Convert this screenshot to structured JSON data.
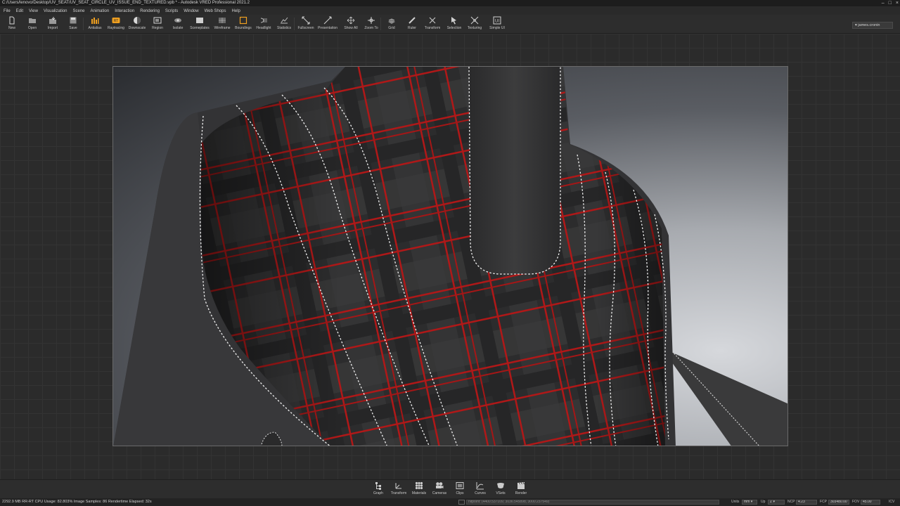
{
  "window": {
    "title": "C:/Users/lenovo/Desktop/UV_SEAT/UV_SEAT_CIRCLE_UV_ISSUE_END_TEXTURED.vpb * - Autodesk VRED Professional 2021.2"
  },
  "menu": [
    "File",
    "Edit",
    "View",
    "Visualization",
    "Scene",
    "Animation",
    "Interaction",
    "Rendering",
    "Scripts",
    "Window",
    "Web Shops",
    "Help"
  ],
  "toolbar": {
    "tools": [
      {
        "label": "New",
        "icon": "new-file-icon"
      },
      {
        "label": "Open",
        "icon": "open-folder-icon"
      },
      {
        "label": "Import",
        "icon": "import-icon"
      },
      {
        "label": "Save",
        "icon": "save-icon"
      },
      {
        "label": "Antialias",
        "icon": "antialias-icon"
      },
      {
        "label": "Raytracing",
        "icon": "raytracing-icon"
      },
      {
        "label": "Downscale",
        "icon": "downscale-icon"
      },
      {
        "label": "Region",
        "icon": "region-icon"
      },
      {
        "label": "Isolate",
        "icon": "isolate-icon"
      },
      {
        "label": "Sceneplates",
        "icon": "sceneplates-icon"
      },
      {
        "label": "Wireframe",
        "icon": "wireframe-icon"
      },
      {
        "label": "Boundings",
        "icon": "boundings-icon"
      },
      {
        "label": "Headlight",
        "icon": "headlight-icon"
      },
      {
        "label": "Statistics",
        "icon": "statistics-icon"
      },
      {
        "label": "Fullscreen",
        "icon": "fullscreen-icon"
      },
      {
        "label": "Presentation",
        "icon": "presentation-icon"
      },
      {
        "label": "Show All",
        "icon": "show-all-icon"
      },
      {
        "label": "Zoom To",
        "icon": "zoom-to-icon"
      },
      {
        "label": "Grid",
        "icon": "grid-icon"
      },
      {
        "label": "Ruler",
        "icon": "ruler-icon"
      },
      {
        "label": "Transform",
        "icon": "transform-icon"
      },
      {
        "label": "Selection",
        "icon": "selection-icon"
      },
      {
        "label": "Texturing",
        "icon": "texturing-icon"
      },
      {
        "label": "Simple UI",
        "icon": "simple-ui-icon"
      }
    ],
    "user": "james.cronin"
  },
  "modules": [
    {
      "label": "Graph",
      "icon": "graph-icon"
    },
    {
      "label": "Transform",
      "icon": "transform-icon"
    },
    {
      "label": "Materials",
      "icon": "materials-icon"
    },
    {
      "label": "Cameras",
      "icon": "cameras-icon"
    },
    {
      "label": "Clips",
      "icon": "clips-icon"
    },
    {
      "label": "Curves",
      "icon": "curves-icon"
    },
    {
      "label": "VSets",
      "icon": "vsets-icon"
    },
    {
      "label": "Render",
      "icon": "render-icon"
    }
  ],
  "status": {
    "text": "2292.9 MB  RR-RT CPU Usage: 82.803% Image Samples: 86 Rendertime Elapsed: 32s",
    "command": "hitpoint: (4400.537109, 3036.545898, 3000.237549)",
    "units_label": "Units",
    "units_value": "mm",
    "up_label": "Up",
    "up_value": "Z",
    "ncp_label": "NCP",
    "ncp_value": "4.23",
    "fcp_label": "FCP",
    "fcp_value": "303480.00",
    "fov_label": "FOV",
    "fov_value": "45.00",
    "icv_label": "ICV"
  },
  "colors": {
    "accent": "#f0a020",
    "fabric": "#2e2e2e",
    "tartan_red": "#b01818",
    "stitch": "#f2f2f2"
  }
}
